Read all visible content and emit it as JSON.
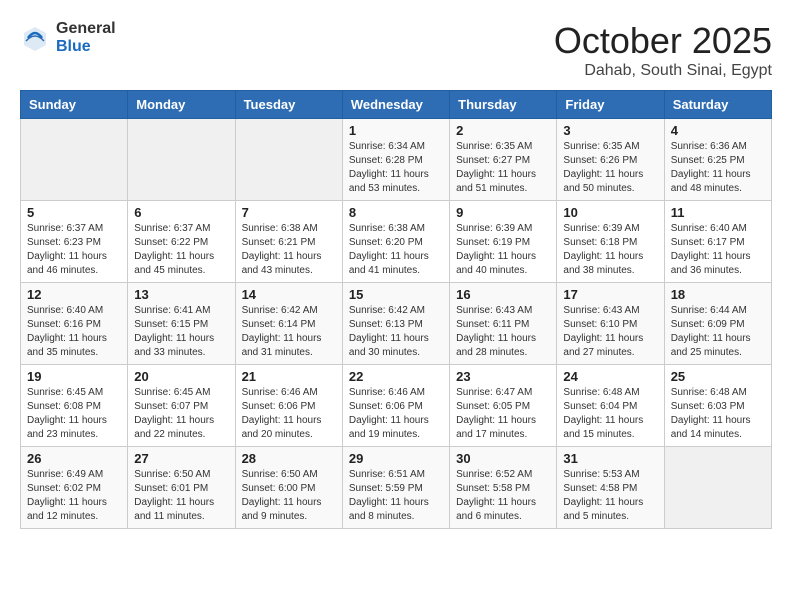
{
  "header": {
    "logo_general": "General",
    "logo_blue": "Blue",
    "month_title": "October 2025",
    "location": "Dahab, South Sinai, Egypt"
  },
  "days_of_week": [
    "Sunday",
    "Monday",
    "Tuesday",
    "Wednesday",
    "Thursday",
    "Friday",
    "Saturday"
  ],
  "weeks": [
    [
      {
        "day": "",
        "info": ""
      },
      {
        "day": "",
        "info": ""
      },
      {
        "day": "",
        "info": ""
      },
      {
        "day": "1",
        "info": "Sunrise: 6:34 AM\nSunset: 6:28 PM\nDaylight: 11 hours\nand 53 minutes."
      },
      {
        "day": "2",
        "info": "Sunrise: 6:35 AM\nSunset: 6:27 PM\nDaylight: 11 hours\nand 51 minutes."
      },
      {
        "day": "3",
        "info": "Sunrise: 6:35 AM\nSunset: 6:26 PM\nDaylight: 11 hours\nand 50 minutes."
      },
      {
        "day": "4",
        "info": "Sunrise: 6:36 AM\nSunset: 6:25 PM\nDaylight: 11 hours\nand 48 minutes."
      }
    ],
    [
      {
        "day": "5",
        "info": "Sunrise: 6:37 AM\nSunset: 6:23 PM\nDaylight: 11 hours\nand 46 minutes."
      },
      {
        "day": "6",
        "info": "Sunrise: 6:37 AM\nSunset: 6:22 PM\nDaylight: 11 hours\nand 45 minutes."
      },
      {
        "day": "7",
        "info": "Sunrise: 6:38 AM\nSunset: 6:21 PM\nDaylight: 11 hours\nand 43 minutes."
      },
      {
        "day": "8",
        "info": "Sunrise: 6:38 AM\nSunset: 6:20 PM\nDaylight: 11 hours\nand 41 minutes."
      },
      {
        "day": "9",
        "info": "Sunrise: 6:39 AM\nSunset: 6:19 PM\nDaylight: 11 hours\nand 40 minutes."
      },
      {
        "day": "10",
        "info": "Sunrise: 6:39 AM\nSunset: 6:18 PM\nDaylight: 11 hours\nand 38 minutes."
      },
      {
        "day": "11",
        "info": "Sunrise: 6:40 AM\nSunset: 6:17 PM\nDaylight: 11 hours\nand 36 minutes."
      }
    ],
    [
      {
        "day": "12",
        "info": "Sunrise: 6:40 AM\nSunset: 6:16 PM\nDaylight: 11 hours\nand 35 minutes."
      },
      {
        "day": "13",
        "info": "Sunrise: 6:41 AM\nSunset: 6:15 PM\nDaylight: 11 hours\nand 33 minutes."
      },
      {
        "day": "14",
        "info": "Sunrise: 6:42 AM\nSunset: 6:14 PM\nDaylight: 11 hours\nand 31 minutes."
      },
      {
        "day": "15",
        "info": "Sunrise: 6:42 AM\nSunset: 6:13 PM\nDaylight: 11 hours\nand 30 minutes."
      },
      {
        "day": "16",
        "info": "Sunrise: 6:43 AM\nSunset: 6:11 PM\nDaylight: 11 hours\nand 28 minutes."
      },
      {
        "day": "17",
        "info": "Sunrise: 6:43 AM\nSunset: 6:10 PM\nDaylight: 11 hours\nand 27 minutes."
      },
      {
        "day": "18",
        "info": "Sunrise: 6:44 AM\nSunset: 6:09 PM\nDaylight: 11 hours\nand 25 minutes."
      }
    ],
    [
      {
        "day": "19",
        "info": "Sunrise: 6:45 AM\nSunset: 6:08 PM\nDaylight: 11 hours\nand 23 minutes."
      },
      {
        "day": "20",
        "info": "Sunrise: 6:45 AM\nSunset: 6:07 PM\nDaylight: 11 hours\nand 22 minutes."
      },
      {
        "day": "21",
        "info": "Sunrise: 6:46 AM\nSunset: 6:06 PM\nDaylight: 11 hours\nand 20 minutes."
      },
      {
        "day": "22",
        "info": "Sunrise: 6:46 AM\nSunset: 6:06 PM\nDaylight: 11 hours\nand 19 minutes."
      },
      {
        "day": "23",
        "info": "Sunrise: 6:47 AM\nSunset: 6:05 PM\nDaylight: 11 hours\nand 17 minutes."
      },
      {
        "day": "24",
        "info": "Sunrise: 6:48 AM\nSunset: 6:04 PM\nDaylight: 11 hours\nand 15 minutes."
      },
      {
        "day": "25",
        "info": "Sunrise: 6:48 AM\nSunset: 6:03 PM\nDaylight: 11 hours\nand 14 minutes."
      }
    ],
    [
      {
        "day": "26",
        "info": "Sunrise: 6:49 AM\nSunset: 6:02 PM\nDaylight: 11 hours\nand 12 minutes."
      },
      {
        "day": "27",
        "info": "Sunrise: 6:50 AM\nSunset: 6:01 PM\nDaylight: 11 hours\nand 11 minutes."
      },
      {
        "day": "28",
        "info": "Sunrise: 6:50 AM\nSunset: 6:00 PM\nDaylight: 11 hours\nand 9 minutes."
      },
      {
        "day": "29",
        "info": "Sunrise: 6:51 AM\nSunset: 5:59 PM\nDaylight: 11 hours\nand 8 minutes."
      },
      {
        "day": "30",
        "info": "Sunrise: 6:52 AM\nSunset: 5:58 PM\nDaylight: 11 hours\nand 6 minutes."
      },
      {
        "day": "31",
        "info": "Sunrise: 5:53 AM\nSunset: 4:58 PM\nDaylight: 11 hours\nand 5 minutes."
      },
      {
        "day": "",
        "info": ""
      }
    ]
  ]
}
